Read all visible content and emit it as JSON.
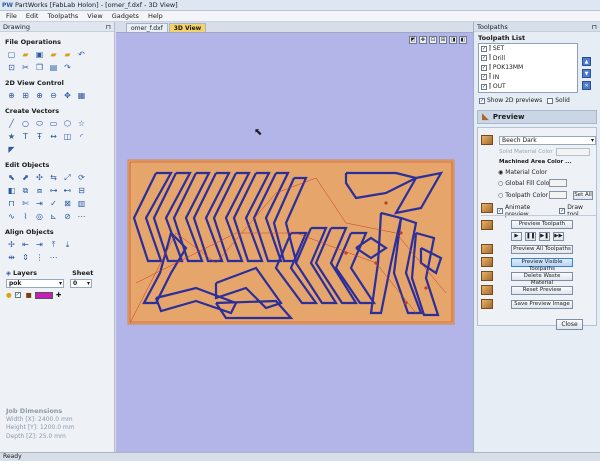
{
  "window": {
    "title": "PartWorks [FabLab Holon] - [omer_f.dxf - 3D View]",
    "logo": "PW"
  },
  "menu": [
    "File",
    "Edit",
    "Toolpaths",
    "View",
    "Gadgets",
    "Help"
  ],
  "left_panel": {
    "header": "Drawing",
    "sections": {
      "file_ops": "File Operations",
      "view_ctrl": "2D View Control",
      "create_vec": "Create Vectors",
      "edit_obj": "Edit Objects",
      "align_obj": "Align Objects"
    },
    "layers_label": "Layers",
    "sheet_label": "Sheet",
    "layer_value": "pok",
    "sheet_value": "0",
    "job": {
      "title": "Job Dimensions",
      "width": "Width  [X]: 2400.0 mm",
      "height": "Height [Y]: 1200.0 mm",
      "depth": "Depth  [Z]: 25.0 mm"
    }
  },
  "tabs": [
    "omer_f.dxf",
    "3D View"
  ],
  "right_panel": {
    "header": "Toolpaths",
    "list_title": "Toolpath List",
    "toolpaths": [
      "SET",
      "Drill",
      "POK13MM",
      "IN",
      "OUT"
    ],
    "show2d": "Show 2D previews",
    "solid": "Solid",
    "preview_header": "Preview",
    "material_value": "Beech Dark",
    "solid_material_color": "Solid Material Color",
    "machined_area": "Machined Area Color ...",
    "radio_material": "Material Color",
    "radio_global": "Global Fill Color",
    "radio_toolpath": "Toolpath Color",
    "set_all": "Set All",
    "animate": "Animate preview",
    "draw_tool": "Draw tool",
    "btn_preview_toolpath": "Preview Toolpath",
    "btn_preview_all": "Preview All Toolpaths",
    "btn_preview_visible": "Preview Visible Toolpaths",
    "btn_delete_waste": "Delete Waste Material",
    "btn_reset": "Reset Preview",
    "btn_save_image": "Save Preview Image",
    "close": "Close"
  },
  "status": "Ready",
  "colors": {
    "sheet": "#e6a56a",
    "toolpath": "#2a2f9c",
    "background": "#b3b5e8"
  }
}
